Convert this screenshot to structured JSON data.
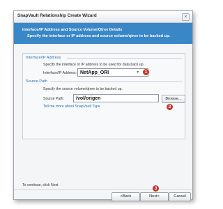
{
  "window": {
    "title": "SnapVault Relationship Create Wizard",
    "close_glyph": "×"
  },
  "header": {
    "title": "Interface/IP Address and Source Volume/Qtree Details",
    "description": "Specify the interface or IP address and source volume/qtree to be backed up."
  },
  "interface_section": {
    "heading": "Interface/IP Address",
    "description": "Specify the interface or IP address to be used for data back up.",
    "field_label": "Interface/IP Address:",
    "field_value": "NetApp_ORI",
    "dropdown_arrow": "▼"
  },
  "source_section": {
    "heading": "Source Path",
    "description": "Specify the source volume/qtree to be backed up.",
    "field_label": "Source Path:",
    "field_value": "/vol/origen",
    "browse_label": "Browse...",
    "help_link": "Tell me more about SnapVault Type"
  },
  "footer": {
    "instruction": "To continue, click Next",
    "back_label": "<Back",
    "next_label": "Next>",
    "cancel_label": "Cancel"
  },
  "step_markers": [
    "1",
    "2",
    "3"
  ],
  "colors": {
    "header_band": "#3a87c7",
    "step_marker": "#c0392b",
    "section_heading": "#2f6fb0"
  }
}
